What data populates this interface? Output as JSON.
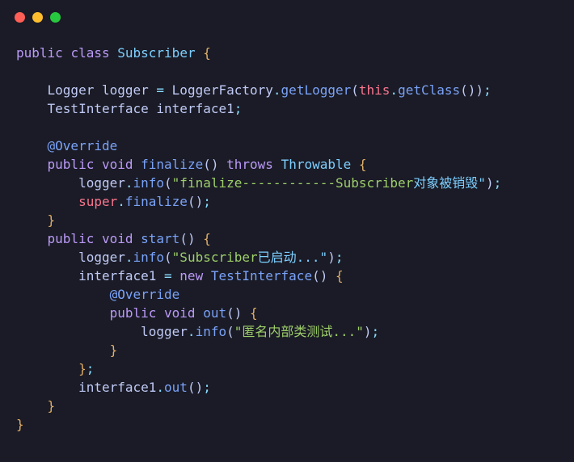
{
  "dots": {
    "red": "#ff5f56",
    "yellow": "#ffbd2e",
    "green": "#27c93f"
  },
  "t": {
    "public": "public",
    "class": "class",
    "Subscriber": "Subscriber",
    "Logger": "Logger",
    "logger": "logger",
    "LoggerFactory": "LoggerFactory",
    "getLogger": "getLogger",
    "this": "this",
    "getClass": "getClass",
    "TestInterface": "TestInterface",
    "interface1": "interface1",
    "Override": "@Override",
    "void": "void",
    "finalize": "finalize",
    "throws": "throws",
    "Throwable": "Throwable",
    "info": "info",
    "str_finalize": "\"finalize------------Subscriber",
    "str_finalize_cn": "对象被销毁\"",
    "super": "super",
    "start": "start",
    "str_start": "\"Subscriber",
    "str_start_cn": "已启动...\"",
    "new": "new",
    "out": "out",
    "str_out": "\"匿名内部类测试...\"",
    "eq": " = ",
    "dot": ".",
    "semi": ";",
    "lparen": "(",
    "rparen": ")",
    "lbrace": "{",
    "rbrace": "}",
    "sp": " "
  }
}
